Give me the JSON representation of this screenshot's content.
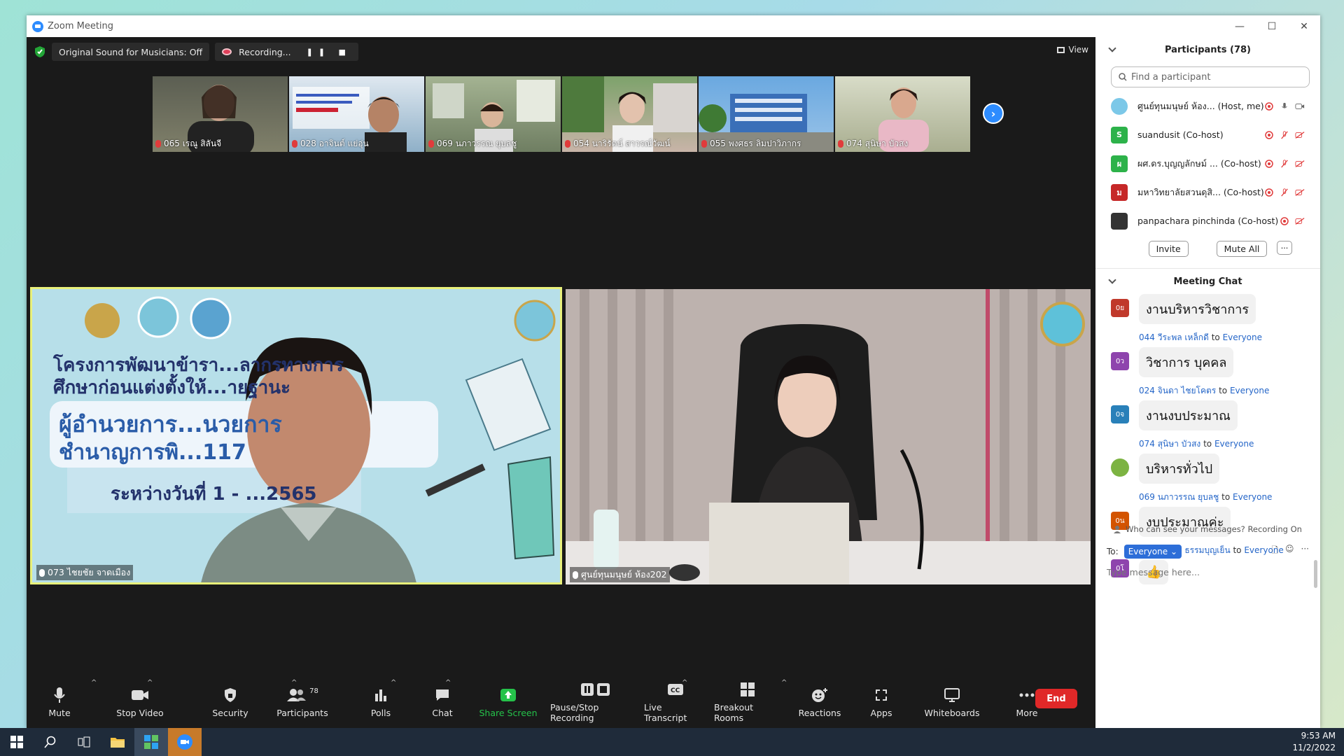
{
  "window": {
    "title": "Zoom Meeting",
    "min": "—",
    "max": "☐",
    "close": "✕"
  },
  "topbar": {
    "original_sound": "Original Sound for Musicians: Off",
    "recording": "Recording...",
    "rec_controls": "❚❚ ■",
    "view": "View"
  },
  "thumbnails": [
    {
      "name": "065 เรณู สิลันจี",
      "bg": "#6b6f5a"
    },
    {
      "name": "028 อาจินต์ แย่อุ่น",
      "bg": "#7fa6bf"
    },
    {
      "name": "069 นภาวรรณ ยุบลชู",
      "bg": "#8a9a78"
    },
    {
      "name": "054 นาริรัตน์ สาวรณ์วัฒน์",
      "bg": "#a08c80"
    },
    {
      "name": "055 พงศธร ลิมปาวิภากร",
      "bg": "#4b88c4"
    },
    {
      "name": "074 สุนิษา บัวสง",
      "bg": "#9aa17f"
    }
  ],
  "big_videos": {
    "left": {
      "name": "073 ไชยชัย จาดเมือง",
      "banner_line1": "โครงการพัฒนาข้ารา...ลากรทางการ",
      "banner_line2": "ศึกษาก่อนแต่งตั้งให้...ายฐานะ",
      "banner_line3": "ผู้อำนวยการ...นวยการ",
      "banner_line4": "ชำนาญการพิ...117",
      "banner_line5": "ระหว่างวันที่ 1 - ...2565"
    },
    "right": {
      "name": "ศูนย์ทุนมนุษย์ ห้อง202"
    }
  },
  "toolbar": {
    "mute": "Mute",
    "stop_video": "Stop Video",
    "security": "Security",
    "participants": "Participants",
    "participants_count": "78",
    "polls": "Polls",
    "chat": "Chat",
    "share_screen": "Share Screen",
    "pause_stop_recording": "Pause/Stop Recording",
    "live_transcript": "Live Transcript",
    "breakout_rooms": "Breakout Rooms",
    "reactions": "Reactions",
    "apps": "Apps",
    "whiteboards": "Whiteboards",
    "more": "More",
    "end": "End",
    "caret": "^"
  },
  "participants_panel": {
    "title": "Participants (78)",
    "search_placeholder": "Find a participant",
    "list": [
      {
        "name": "ศูนย์ทุนมนุษย์ ห้อง... (Host, me)",
        "avatar": "",
        "color": "#7cc8e8"
      },
      {
        "name": "suandusit (Co-host)",
        "avatar": "S",
        "color": "#2db24a"
      },
      {
        "name": "ผศ.ดร.บุญญลักษม์ ... (Co-host)",
        "avatar": "ผ",
        "color": "#2db24a"
      },
      {
        "name": "มหาวิทยาลัยสวนดุสิ... (Co-host)",
        "avatar": "ม",
        "color": "#c62828"
      },
      {
        "name": "panpachara pinchinda (Co-host)",
        "avatar": "",
        "color": "#333"
      }
    ],
    "invite": "Invite",
    "mute_all": "Mute All",
    "more": "···"
  },
  "chat_panel": {
    "title": "Meeting Chat",
    "messages": [
      {
        "sender": "",
        "to": "",
        "text": "งานบริหารวิชาการ",
        "avatar": "0ย",
        "color": "#c0392b"
      },
      {
        "sender": "044 วีระพล เหล็กดี",
        "to": "Everyone",
        "text": "วิชาการ บุคคล",
        "avatar": "0ว",
        "color": "#8e44ad"
      },
      {
        "sender": "024 จินดา ไชยโคตร",
        "to": "Everyone",
        "text": "งานงบประมาณ",
        "avatar": "0จ",
        "color": "#2980b9"
      },
      {
        "sender": "074 สุนิษา บัวสง",
        "to": "Everyone",
        "text": "บริหารทั่วไป",
        "avatar": "",
        "color": "#7cb342"
      },
      {
        "sender": "069 นภาวรรณ ยุบลชู",
        "to": "Everyone",
        "text": "งบประมาณค่ะ",
        "avatar": "0น",
        "color": "#d35400"
      },
      {
        "sender": "005 โยธกา ธรรมบุญเย็น",
        "to": "Everyone",
        "text": "👍",
        "avatar": "0โ",
        "color": "#8e44ad"
      }
    ],
    "to_word": "to",
    "who_can_see": "Who can see your messages? Recording On",
    "to_label": "To:",
    "everyone": "Everyone",
    "type_placeholder": "Type message here..."
  },
  "taskbar": {
    "time": "9:53 AM",
    "date": "11/2/2022"
  }
}
